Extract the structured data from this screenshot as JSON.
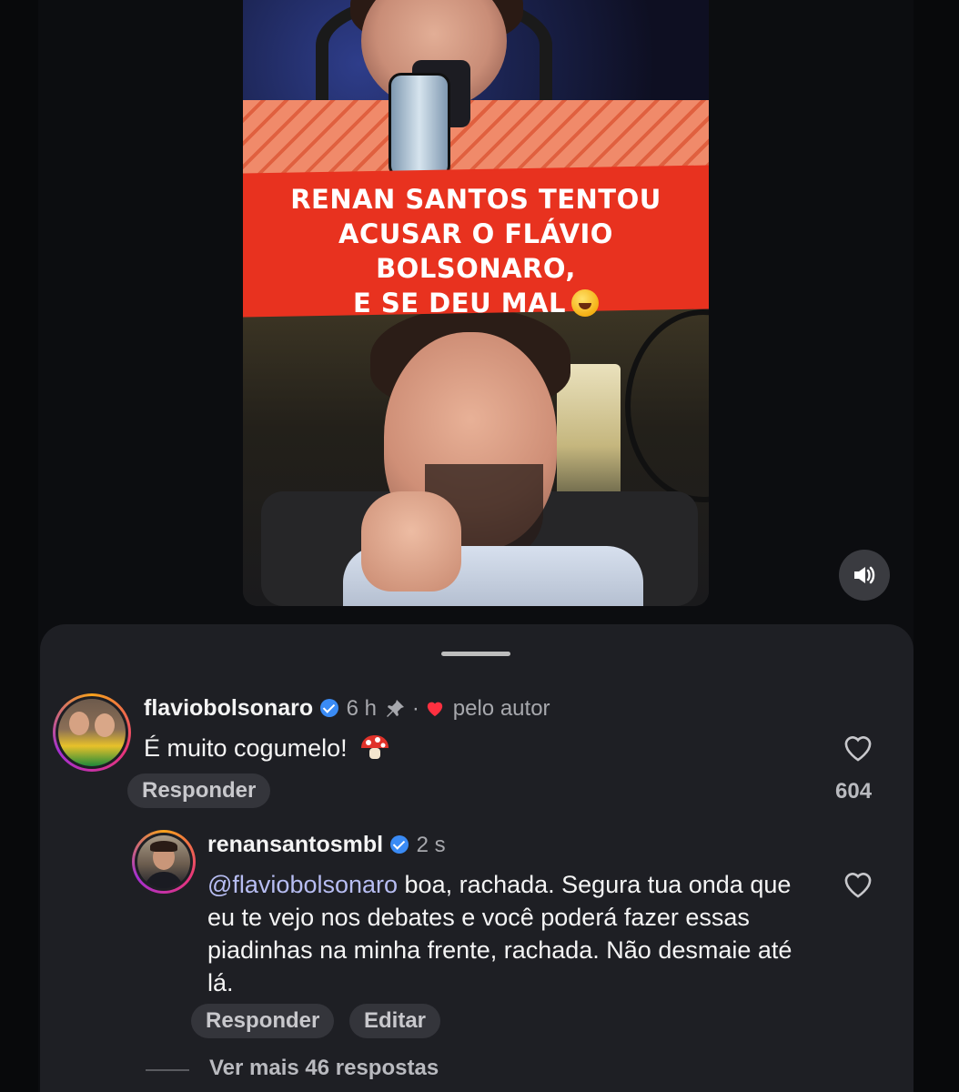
{
  "video": {
    "caption_line1": "RENAN SANTOS TENTOU",
    "caption_line2": "ACUSAR O FLÁVIO BOLSONARO,",
    "caption_line3": "E SE DEU MAL",
    "caption_emoji": "rolling-on-floor-laughing-emoji",
    "volume_icon": "speaker-icon"
  },
  "comments": [
    {
      "username": "flaviobolsonaro",
      "time": "6 h",
      "pinned_icon": "pin-icon",
      "separator": "·",
      "liked_by_author": "pelo autor",
      "text": "É muito cogumelo!",
      "text_emoji": "mushroom-emoji",
      "reply_label": "Responder",
      "like_count": "604"
    },
    {
      "username": "renansantosmbl",
      "time": "2 s",
      "mention": "@flaviobolsonaro",
      "text": " boa, rachada. Segura tua onda que eu te vejo nos debates e você poderá fazer essas piadinhas na minha frente, rachada. Não desmaie até lá.",
      "reply_label": "Responder",
      "edit_label": "Editar"
    }
  ],
  "more_replies": "Ver mais 46 respostas",
  "colors": {
    "background": "#0c0d10",
    "sheet": "#1e1f24",
    "banner": "#e8321f",
    "verified": "#3a8bf5",
    "heart_red": "#ff3040",
    "mention": "#b7bdf2"
  }
}
